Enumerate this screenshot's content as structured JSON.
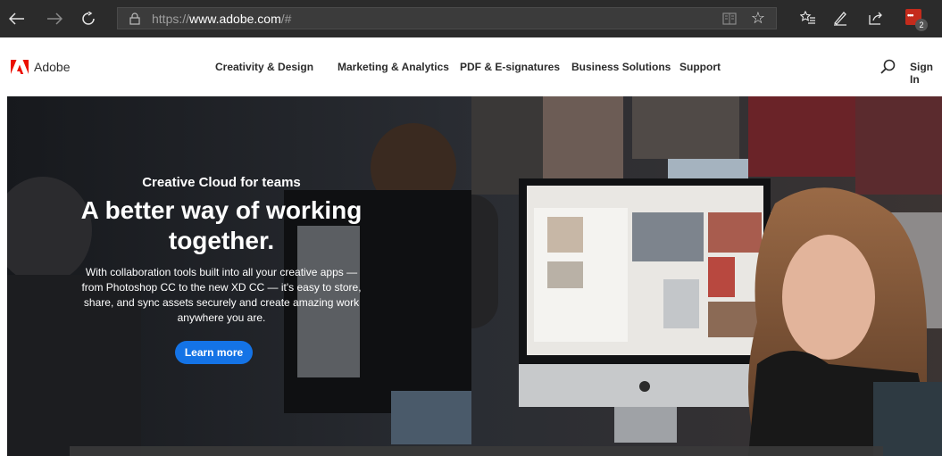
{
  "browser": {
    "url_scheme": "https://",
    "url_host": "www.adobe.com",
    "url_path": "/#",
    "extension_badge": "2",
    "extension_dots": "•••"
  },
  "header": {
    "brand": "Adobe",
    "nav": [
      {
        "label": "Creativity & Design"
      },
      {
        "label": "Marketing & Analytics"
      },
      {
        "label": "PDF & E-signatures"
      },
      {
        "label": "Business Solutions"
      },
      {
        "label": "Support"
      }
    ],
    "signin": "Sign In"
  },
  "hero": {
    "eyebrow": "Creative Cloud for teams",
    "headline": "A better way of working together.",
    "body": "With collaboration tools built into all your creative apps — from Photoshop CC to the new XD CC — it's easy to store, share, and sync assets securely and create amazing work anywhere you are.",
    "cta": "Learn more"
  },
  "colors": {
    "chrome_bg": "#2b2b2b",
    "adobe_red": "#eb1000",
    "cta_blue": "#1473e6",
    "extension_red": "#c42b1c"
  },
  "icons": [
    "back-icon",
    "forward-icon",
    "refresh-icon",
    "lock-icon",
    "reading-view-icon",
    "favorite-star-icon",
    "favorites-list-icon",
    "pen-icon",
    "share-icon",
    "search-icon"
  ]
}
